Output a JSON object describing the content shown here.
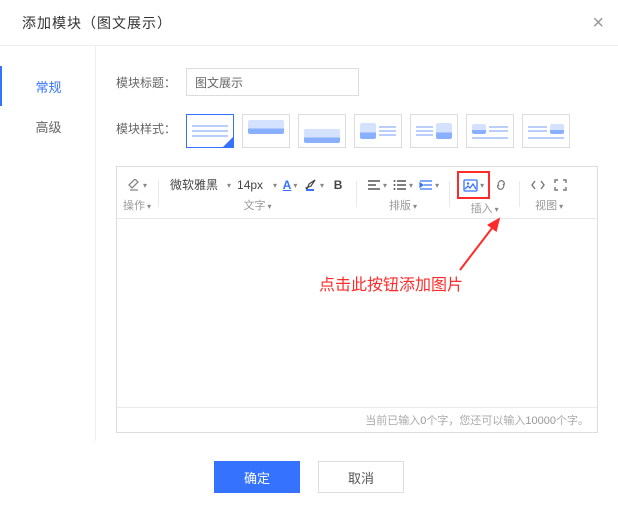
{
  "dialog": {
    "title": "添加模块（图文展示）"
  },
  "tabs": {
    "general": "常规",
    "advanced": "高级"
  },
  "form": {
    "title_label": "模块标题：",
    "title_value": "图文展示",
    "style_label": "模块样式："
  },
  "toolbar": {
    "group_op": "操作",
    "group_text": "文字",
    "group_layout": "排版",
    "group_insert": "插入",
    "group_view": "视图",
    "font_family": "微软雅黑",
    "font_size": "14px"
  },
  "callout": {
    "text": "点击此按钮添加图片"
  },
  "footer": {
    "count_prefix": "当前已输入",
    "count_cur": "0",
    "count_mid": "个字，您还可以输入",
    "count_max": "10000",
    "count_suffix": "个字。"
  },
  "buttons": {
    "ok": "确定",
    "cancel": "取消"
  }
}
